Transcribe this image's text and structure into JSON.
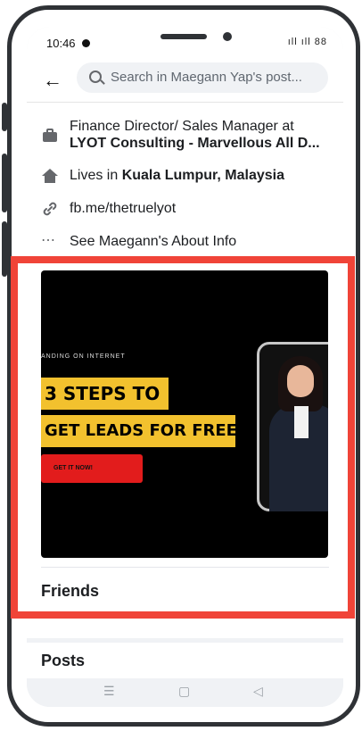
{
  "status_bar": {
    "time": "10:46",
    "right_icons": "ıll ıll 88"
  },
  "search": {
    "placeholder": "Search in Maegann Yap's post..."
  },
  "intro": {
    "job": {
      "line1": "Finance Director/ Sales Manager at",
      "line2": "LYOT Consulting - Marvellous All D..."
    },
    "lives": {
      "prefix": "Lives in ",
      "place": "Kuala Lumpur, Malaysia"
    },
    "link": "fb.me/thetruelyot",
    "about": "See Maegann's About Info"
  },
  "ad": {
    "small_text": "ANDING ON INTERNET",
    "line1": "3 STEPS TO",
    "line2": "GET LEADS FOR FREE!",
    "cta": "GET IT NOW!"
  },
  "sections": {
    "friends": "Friends",
    "posts": "Posts"
  },
  "icons": {
    "back": "back-arrow-icon",
    "search": "search-icon",
    "job": "briefcase-icon",
    "lives": "home-icon",
    "link": "link-icon",
    "about": "more-icon"
  },
  "colors": {
    "highlight": "#f04438",
    "ad_yellow": "#f2c12e",
    "cta_red": "#e21c1c"
  }
}
